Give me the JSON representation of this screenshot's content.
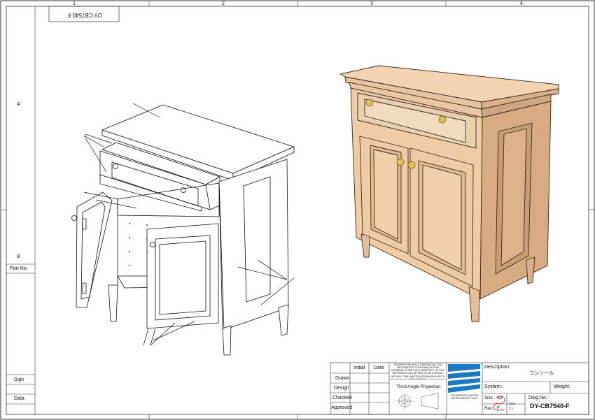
{
  "sheet": {
    "zones_top": [
      "1",
      "2",
      "3",
      "4"
    ],
    "zones_side": [
      "A",
      "B"
    ],
    "mirrored_tab": "DY-CB7540-F"
  },
  "left_column": {
    "part_no_label": "Part No.",
    "sign_label": "Sign",
    "data_label": "Data"
  },
  "title_block": {
    "col_initial": "Initial",
    "col_date": "Date",
    "rows": [
      "Drawn",
      "Design",
      "Checked",
      "Approved"
    ],
    "proprietary_text": "PROPRIETARY AND CONFIDENTIAL THE INFORMATION CONTAINED IN THIS DRAWING IS THE SOLE PROPERTY OF ANY REPRODUCTION IN PART OR AS A WHOLE WITHOUT THE WRITTEN PERMISSION OF IS PROHIBITED",
    "projection_label": "Third Angle Projection",
    "tolerances_text": "TOLERANCES UNLESS NOTED ANGLES ±0.5°",
    "description_label": "Description:",
    "description_value": "コンソール",
    "system_label": "System:",
    "weight_label": "Weight:",
    "size_label": "Size:",
    "size_value": "A3",
    "rev_label": "Rev:",
    "rev_value": "F",
    "scale_label": "Scal",
    "scale_value": "1:1",
    "dwg_no_label": "Dwg.No.:",
    "dwg_no_value": "DY-CB7540-F"
  }
}
